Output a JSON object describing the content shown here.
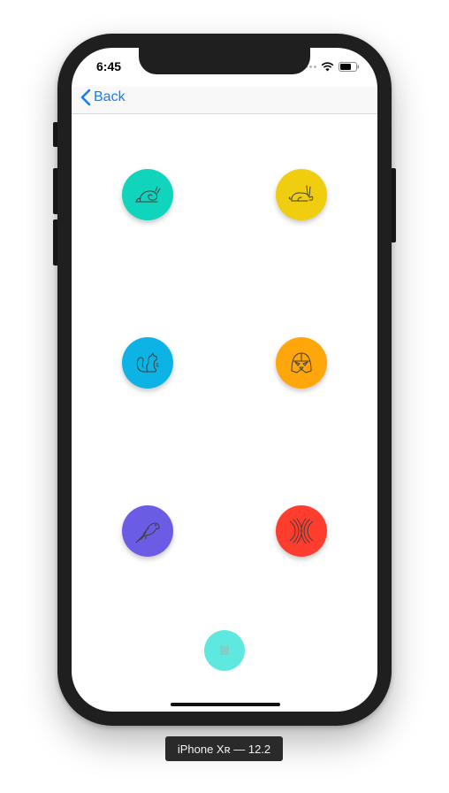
{
  "status_bar": {
    "time": "6:45"
  },
  "nav": {
    "back_label": "Back"
  },
  "buttons": [
    {
      "name": "snail",
      "color": "#11d4bd"
    },
    {
      "name": "rabbit",
      "color": "#f0cd0e"
    },
    {
      "name": "squirrel",
      "color": "#0eb3e6"
    },
    {
      "name": "darth-vader",
      "color": "#ffa60a"
    },
    {
      "name": "parrot",
      "color": "#6b5ce6"
    },
    {
      "name": "abstract-waves",
      "color": "#ff3d2e"
    }
  ],
  "stop_button": {
    "color": "#5ee8e0"
  },
  "device_label": "iPhone Xʀ — 12.2"
}
